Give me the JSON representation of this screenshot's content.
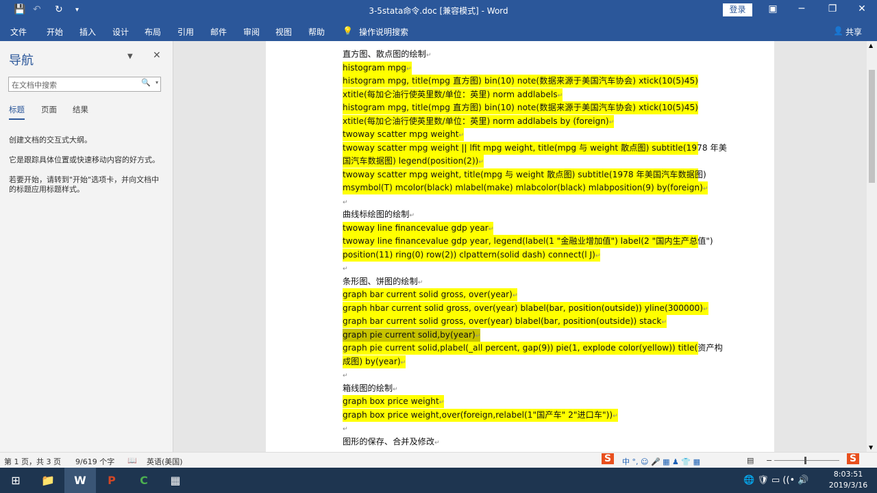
{
  "titlebar": {
    "title": "3-5stata命令.doc [兼容模式] - Word",
    "login": "登录",
    "save_icon": "save-icon",
    "undo_icon": "undo-icon",
    "redo_icon": "redo-icon"
  },
  "ribbon": {
    "tabs": [
      "文件",
      "开始",
      "插入",
      "设计",
      "布局",
      "引用",
      "邮件",
      "审阅",
      "视图",
      "帮助"
    ],
    "tell_me": "操作说明搜索",
    "share": "共享"
  },
  "nav": {
    "title": "导航",
    "search_placeholder": "在文档中搜索",
    "tabs": [
      "标题",
      "页面",
      "结果"
    ],
    "text1": "创建文档的交互式大纲。",
    "text2": "它是跟踪具体位置或快速移动内容的好方式。",
    "text3": "若要开始，请转到\"开始\"选项卡，并向文档中的标题应用标题样式。"
  },
  "document": {
    "lines": [
      {
        "text": "直方图、散点图的绘制",
        "hl": false
      },
      {
        "text": "histogram mpg",
        "hl": true
      },
      {
        "text": "histogram mpg, title(mpg 直方图) bin(10) note(数据来源于美国汽车协会) xtick(10(5)45)",
        "hl": true,
        "full": true
      },
      {
        "text": "xtitle(每加仑油行使英里数/单位：英里) norm addlabels",
        "hl": true
      },
      {
        "text": "histogram mpg, title(mpg 直方图) bin(10) note(数据来源于美国汽车协会) xtick(10(5)45)",
        "hl": true,
        "full": true
      },
      {
        "text": "xtitle(每加仑油行使英里数/单位：英里) norm addlabels by (foreign)",
        "hl": true
      },
      {
        "text": "twoway scatter mpg weight",
        "hl": true
      },
      {
        "text": "twoway scatter mpg weight || lfit mpg weight, title(mpg 与 weight 散点图) subtitle(1978 年美",
        "hl": true,
        "full": true
      },
      {
        "text": "国汽车数据图) legend(position(2))",
        "hl": true
      },
      {
        "text": "twoway scatter mpg weight, title(mpg 与 weight 散点图) subtitle(1978 年美国汽车数据图)",
        "hl": true,
        "full": true
      },
      {
        "text": "msymbol(T) mcolor(black) mlabel(make) mlabcolor(black) mlabposition(9) by(foreign)",
        "hl": true
      },
      {
        "text": "",
        "hl": false
      },
      {
        "text": "曲线标绘图的绘制",
        "hl": false
      },
      {
        "text": "twoway line financevalue gdp year",
        "hl": true
      },
      {
        "text": "twoway line financevalue gdp year, legend(label(1 \"金融业增加值\") label(2 \"国内生产总值\")",
        "hl": true,
        "full": true
      },
      {
        "text": "position(11) ring(0) row(2)) clpattern(solid dash) connect(l J)",
        "hl": true
      },
      {
        "text": "",
        "hl": false
      },
      {
        "text": "条形图、饼图的绘制",
        "hl": false
      },
      {
        "text": "graph bar current solid gross, over(year)",
        "hl": true
      },
      {
        "text": "graph hbar current solid gross, over(year) blabel(bar, position(outside)) yline(300000)",
        "hl": true
      },
      {
        "text": "graph bar current solid gross, over(year) blabel(bar, position(outside)) stack",
        "hl": true
      },
      {
        "text": "graph pie current solid,by(year)",
        "hl": true,
        "sel": true
      },
      {
        "text": "graph pie current solid,plabel(_all percent, gap(9)) pie(1, explode color(yellow)) title(资产构",
        "hl": true,
        "full": true
      },
      {
        "text": "成图) by(year)",
        "hl": true
      },
      {
        "text": "",
        "hl": false
      },
      {
        "text": "箱线图的绘制",
        "hl": false
      },
      {
        "text": "graph box price weight",
        "hl": true
      },
      {
        "text": "graph box price weight,over(foreign,relabel(1\"国产车\" 2\"进口车\"))",
        "hl": true
      },
      {
        "text": "",
        "hl": false
      },
      {
        "text": "图形的保存、合并及修改",
        "hl": false
      }
    ]
  },
  "status": {
    "page": "第 1 页，共 3 页",
    "words": "9/619 个字",
    "language": "英语(美国)"
  },
  "taskbar": {
    "time": "8:03:51",
    "date": "2019/3/16"
  },
  "colors": {
    "accent": "#2b579a",
    "highlight": "#ffff00"
  }
}
